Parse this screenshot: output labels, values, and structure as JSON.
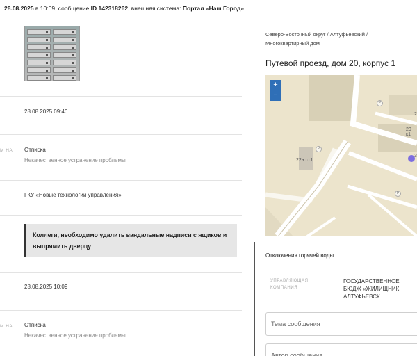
{
  "header": {
    "date": "28.08.2025",
    "time_prefix": "в 10:09, сообщение",
    "id": "ID 142318262",
    "system_prefix": ", внешняя система:",
    "system": "Портал «Наш Город»"
  },
  "left": {
    "created_at": "28.08.2025 09:40",
    "partial_label_1": "М НА",
    "reply_type_1": "Отписка",
    "reply_reason_1": "Некачественное устранение проблемы",
    "organization": "ГКУ «Новые технологии управления»",
    "comment": "Коллеги, необходимо удалить вандальные надписи с ящиков и выпрямить дверцу",
    "updated_at": "28.08.2025 10:09",
    "partial_label_2": "М НА",
    "reply_type_2": "Отписка",
    "reply_reason_2": "Некачественное устранение проблемы"
  },
  "right": {
    "breadcrumb": "Северо-Восточный округ / Алтуфьевский / Многоквартирный дом",
    "address": "Путевой проезд, дом 20, корпус 1",
    "map": {
      "zoom_in": "+",
      "zoom_out": "−",
      "label_building_1": "22а ст1",
      "label_building_2": "20 к1",
      "label_partial_1": "2",
      "label_partial_2": "3",
      "parking_symbol": "P"
    },
    "outage_title": "Отключения горячей воды",
    "manager_label": "УПРАВЛЯЮЩАЯ КОМПАНИЯ",
    "manager_value": "ГОСУДАРСТВЕННОЕ БЮДЖ «ЖИЛИЩНИК АЛТУФЬЕВСК",
    "subject_placeholder": "Тема сообщения",
    "author_placeholder": "Автор сообщения"
  }
}
